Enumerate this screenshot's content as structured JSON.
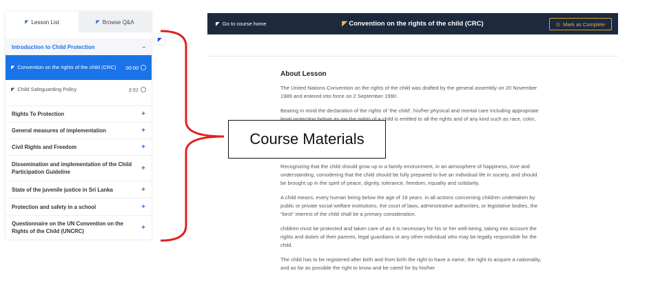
{
  "sidebar": {
    "tab_lessons": "Lesson List",
    "tab_qa": "Browse Q&A",
    "current_topic": "Introduction to Child Protection",
    "current_topic_toggle": "−",
    "lessons": [
      {
        "title": "Convention on the rights of the child (CRC)",
        "duration": "00:00"
      },
      {
        "title": "Child Safeguarding Policy",
        "duration": "3:51"
      }
    ],
    "topics": [
      {
        "title": "Rights To Protection",
        "toggle": "+"
      },
      {
        "title": "General measures of implementation",
        "toggle": "+"
      },
      {
        "title": "Civil Rights and Freedom",
        "toggle": "+"
      },
      {
        "title": "Dissemination and implementation of the Child Participation Guideline",
        "toggle": "+"
      },
      {
        "title": "State of the juvenile justice in Sri Lanka",
        "toggle": "+"
      },
      {
        "title": "Protection and safety in a school",
        "toggle": "+"
      },
      {
        "title": "Questionnaire on the UN Convention on the Rights of the Child (UNCRC)",
        "toggle": "+"
      }
    ]
  },
  "header": {
    "home_label": "Go to course home",
    "title": "Convention on the rights of the child (CRC)",
    "complete_label": "Mark as Complete"
  },
  "annotation": {
    "label": "Course Materials",
    "color": "#e02020"
  },
  "lesson": {
    "heading": "About Lesson",
    "paragraphs": [
      "The United Nations Convention on the rights of the child was drafted by the general assembly on 20 November 1989 and entered into force on 2 September 1990.",
      "Bearing in mind the declaration of the rights of ‘the child’, his/her physical and mental care including appropriate legal protection before as ing the rights of a child is entitled to all the rights and of any kind such as race, color, sex, language,",
      "Recognizing that the child should grow up in a family environment, in an atmosphere of happiness, love and understanding, considering that the child should be fully prepared to live an individual life in society, and should be brought up in the spirit of peace, dignity, tolerance, freedom, equality and solidarity.",
      "A child means, every human being below the age of 18 years. in all actions concerning children undertaken by public or private social welfare institutions, the court of laws, administrative authorities, or legislative bodies, the “best” interest of the child shall be a primary consideration.",
      "children must be protected and taken care of as it is necessary for his or her well-being, taking into account the rights and duties of their parents, legal guardians or any other individual who may be legally responsible for the child.",
      "The child has to be registered after birth and from birth the right to have a name, the right to acquire a nationality, and as far as possible the right to know and be cared for by his/her"
    ]
  },
  "colors": {
    "accent": "#1a73e8",
    "header_bg": "#1d2a3e",
    "complete_border": "#d9a329"
  }
}
